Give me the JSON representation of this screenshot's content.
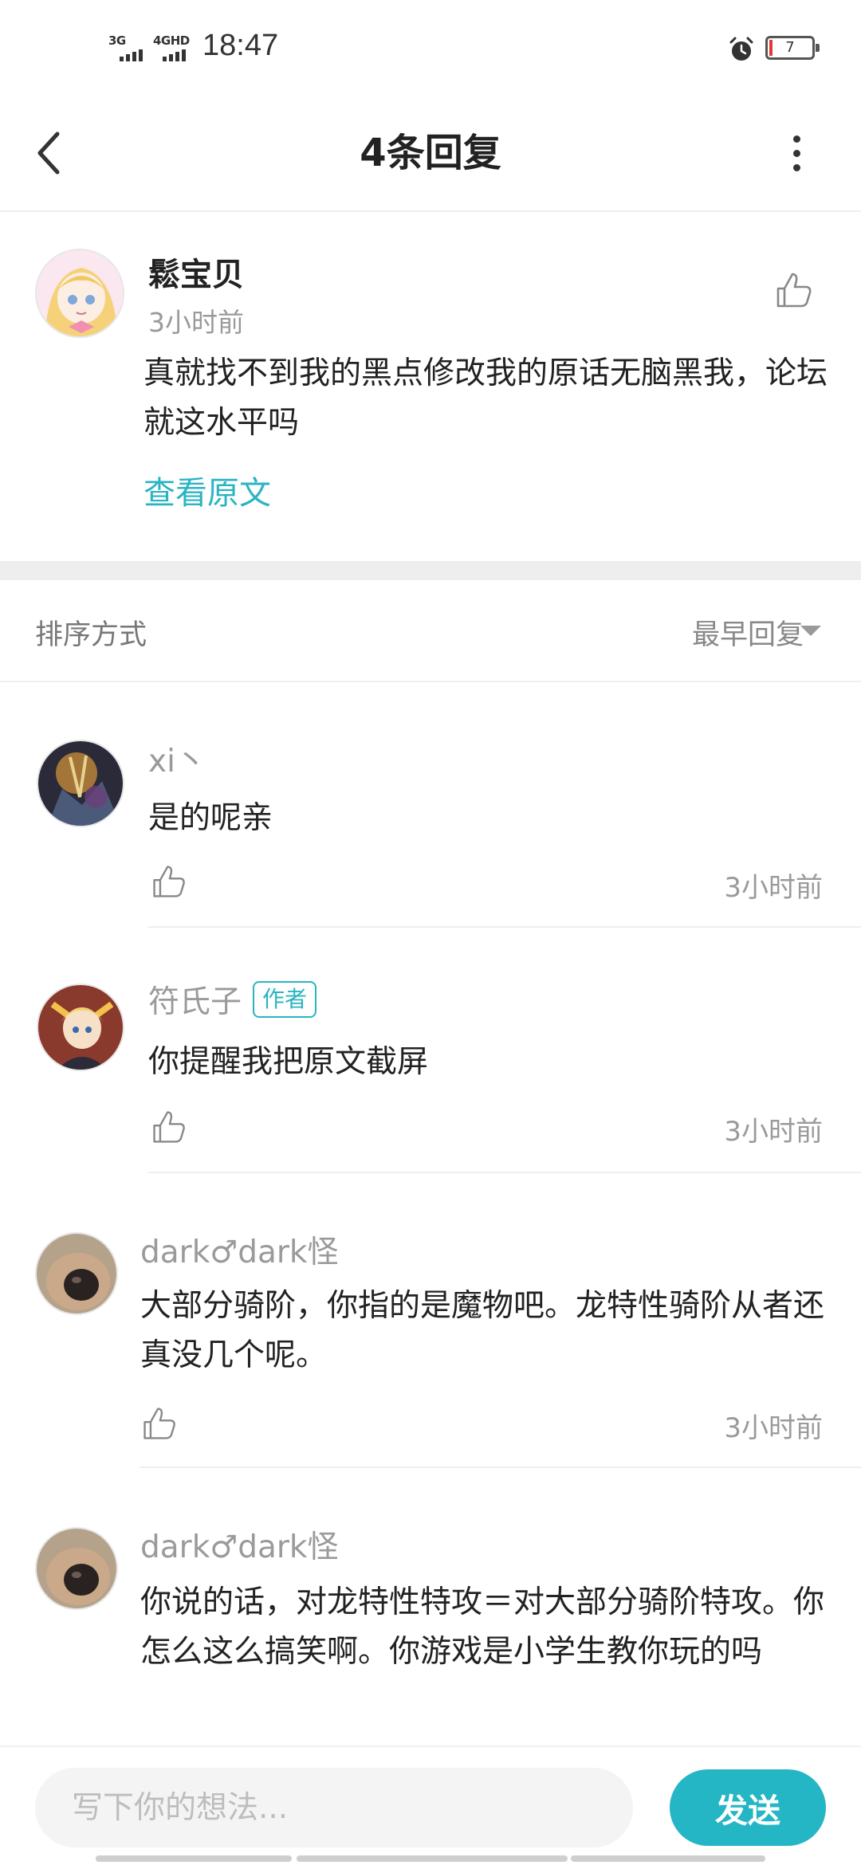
{
  "status_bar": {
    "signal1_label": "3G",
    "signal2_label": "4GHD",
    "time": "18:47",
    "battery": "7"
  },
  "header": {
    "title": "4条回复"
  },
  "post": {
    "username": "鬆宝贝",
    "time": "3小时前",
    "text": "真就找不到我的黑点修改我的原话无脑黑我，论坛就这水平吗",
    "view_original": "查看原文"
  },
  "sort": {
    "label": "排序方式",
    "value": "最早回复"
  },
  "replies": [
    {
      "username": "xi丶",
      "badge": "",
      "text": "是的呢亲",
      "time": "3小时前"
    },
    {
      "username": "符氏子",
      "badge": "作者",
      "text": "你提醒我把原文截屏",
      "time": "3小时前"
    },
    {
      "username": "dark♂dark怪",
      "badge": "",
      "text": "大部分骑阶，你指的是魔物吧。龙特性骑阶从者还真没几个呢。",
      "time": "3小时前"
    },
    {
      "username": "dark♂dark怪",
      "badge": "",
      "text": "你说的话，对龙特性特攻＝对大部分骑阶特攻。你怎么这么搞笑啊。你游戏是小学生教你玩的吗",
      "time": ""
    }
  ],
  "input": {
    "placeholder": "写下你的想法..."
  },
  "send_label": "发送",
  "colors": {
    "accent": "#25b6c6",
    "secondary_text": "#9a9a9a"
  },
  "icons": [
    "back-arrow-icon",
    "more-vertical-icon",
    "thumbs-up-icon",
    "alarm-icon",
    "battery-icon",
    "dropdown-arrow-icon"
  ]
}
